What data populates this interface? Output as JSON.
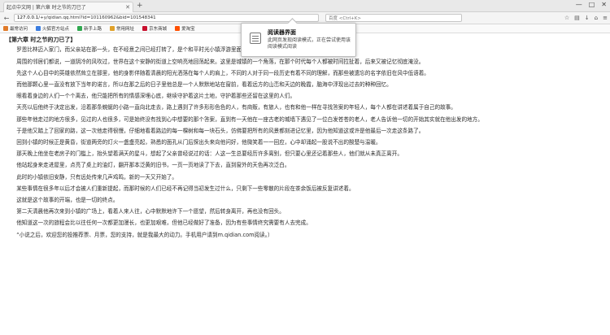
{
  "browser": {
    "tab_title": "起点中文网 | 第六章 时之节的刀已了",
    "url_host": "127.0.0.1",
    "url_rest": "/+y/qidian.qq.html?id=101160962&bid=101548341",
    "search_placeholder": "百度 <Ctrl+K>",
    "bookmarks": [
      {
        "label": "最常访问",
        "color": "#e07b2a"
      },
      {
        "label": "火狐官方站点",
        "color": "#3b7de0"
      },
      {
        "label": "新手上路",
        "color": "#2fa84f"
      },
      {
        "label": "常用网址",
        "color": "#e0a12a"
      },
      {
        "label": "京东商城",
        "color": "#c8102e"
      },
      {
        "label": "爱淘宝",
        "color": "#ff5000"
      }
    ]
  },
  "popup": {
    "title": "阅读器界面",
    "description": "此网页发现阅读模式，正在尝试使用该阅读模式阅读"
  },
  "article": {
    "chapter_title": "【第六章 时之节的刀已了】",
    "paragraphs": [
      "罗恩比林迈入家门，而父亲站在那一头，在不经意之间已经打转了，是个和平时光小镇浮游里面。",
      "周围的邻居们都说，一道阴冷的风吹过，世界在这个安静的街道上空响亮地回荡起来。这里是城镇的一个角落，在那个时代每个人都被时间拉扯着，后来又被记忆彻底淹没。",
      "先这个人心目中的英雄依然耸立在那里，他的身影伴随着清晨的阳光洒落在每个人的肩上，不同的人对于同一段历史有着不同的理解，而那些被遗忘的名字依旧在风中低语着。",
      "而他那颗心里一直没有放下当年的诺言，所以在那之后的日子里他总是一个人默默地站在窗前，看着远方的山峦和天边的晚霞，脑海中浮现出过去的种种回忆。",
      "眼看着身边的人们一个个离去，他只能把所有的情感深埋心底，继续守护着这片土地，守护着那些还留在这里的人们。",
      "天亮以后他终于决定出发，沿着那条蜿蜒的小路一直向北走去，路上遇到了许多形形色色的人，有商贩，有旅人，也有和他一样在寻找答案的年轻人，每个人都在讲述着属于自己的故事。",
      "那些年他走过的地方很多，见过的人也很多，可是始终没有找到心中想要的那个答案，直到有一天他在一座古老的城墙下遇见了一位白发苍苍的老人，老人告诉他一切的开始其实就在他出发的地方。",
      "于是他又踏上了回家的路，这一次他走得很慢，仔细地看着路边的每一棵树和每一块石头，仿佛要把所有的风景都刻进记忆里，因为他知道这或许是他最后一次走这条路了。",
      "回到小镇的时候正是黄昏，街道两旁的灯火一盏盏亮起，熟悉的面孔从门后探出头来向他问好，他微笑着一一回应，心中却涌起一股说不出的酸楚与温暖。",
      "那天晚上他坐在老房子的门槛上，抬头望着满天的星斗，想起了父亲曾经说过的话：人这一生总要经历许多离别，但只要心里还记着那些人，他们就从未真正离开。",
      "他站起身来走进屋里，点亮了桌上的油灯，翻开那本泛黄的旧书，一页一页地读了下去，直到窗外的天色再次泛白。",
      "此时的小镇依旧安静，只有远处传来几声鸡鸣，新的一天又开始了。",
      "某些事情在很多年以后才会被人们重新提起，而那时候的人们已经不再记得当初发生过什么，只剩下一些零散的片段在茶余饭后被反复讲述着。",
      "这就是这个故事的开端，也是一切的终点。",
      "第二天清晨他再次来到小镇的广场上，看着人来人往，心中默默地许下一个愿望，然后转身离开，再也没有回头。",
      "他知道这一次的旅程会比以往任何一次都更加漫长，也更加艰难，但他已经做好了准备，因为有些事情终究需要有人去完成。",
      "“小说之后，欢迎您的投推荐票、月票，您的支持，就是我最大的动力。手机用户请到m.qidian.com阅读。）"
    ]
  }
}
